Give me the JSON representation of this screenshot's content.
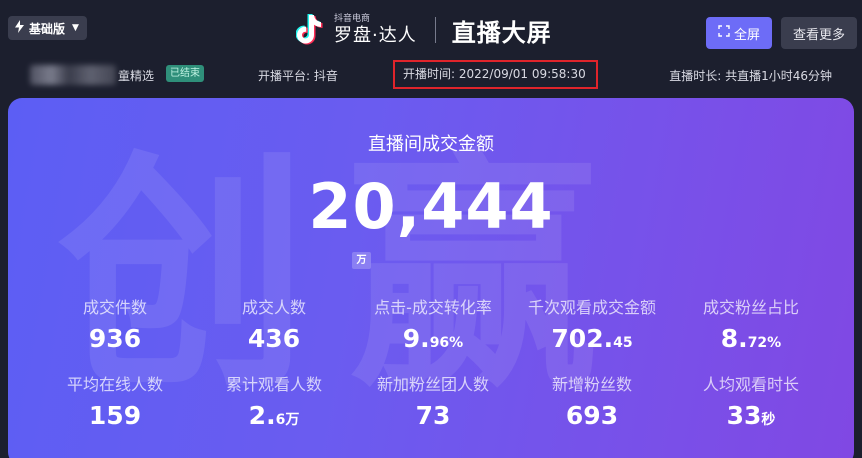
{
  "header": {
    "edition_label": "基础版",
    "brand_small": "抖音电商",
    "brand_main": "罗盘·达人",
    "page_title": "直播大屏",
    "fullscreen_label": "全屏",
    "more_label": "查看更多"
  },
  "info": {
    "shop_name": "童精选",
    "status_badge": "已结束",
    "platform": "开播平台: 抖音",
    "start_time": "开播时间: 2022/09/01 09:58:30",
    "duration": "直播时长: 共直播1小时46分钟"
  },
  "main": {
    "watermark": "创赢",
    "gmv_title": "直播间成交金额",
    "gmv_value": "20,444",
    "gmv_unit": "万"
  },
  "stats": [
    {
      "label": "成交件数",
      "value": "936",
      "suffix": ""
    },
    {
      "label": "成交人数",
      "value": "436",
      "suffix": ""
    },
    {
      "label": "点击-成交转化率",
      "value": "9.",
      "suffix": "96%"
    },
    {
      "label": "千次观看成交金额",
      "value": "702.",
      "suffix": "45"
    },
    {
      "label": "成交粉丝占比",
      "value": "8.",
      "suffix": "72%"
    },
    {
      "label": "平均在线人数",
      "value": "159",
      "suffix": ""
    },
    {
      "label": "累计观看人数",
      "value": "2.",
      "suffix": "6万"
    },
    {
      "label": "新加粉丝团人数",
      "value": "73",
      "suffix": ""
    },
    {
      "label": "新增粉丝数",
      "value": "693",
      "suffix": ""
    },
    {
      "label": "人均观看时长",
      "value": "33",
      "suffix": "秒"
    }
  ],
  "colors": {
    "background": "#1c1f2e",
    "accent": "#6d6cf7",
    "card_start": "#5c5ef4",
    "card_end": "#8048e3",
    "highlight_border": "#e0242b",
    "badge_bg": "#2f8f7a"
  },
  "icons": {
    "edition": "lightning-icon",
    "dropdown": "chevron-down-icon",
    "logo": "tiktok-logo-icon",
    "fullscreen": "expand-icon"
  }
}
